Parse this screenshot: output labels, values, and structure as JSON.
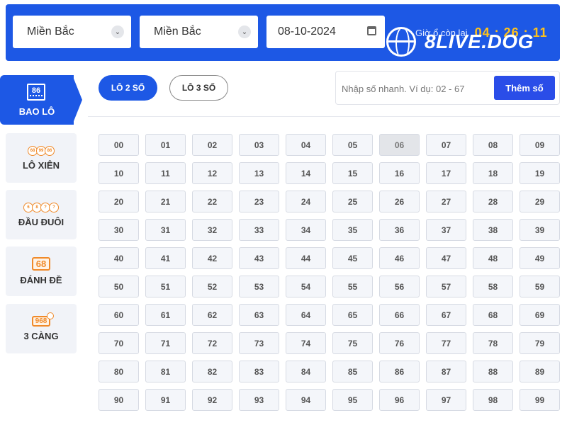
{
  "header": {
    "region1": "Miền Bắc",
    "region2": "Miền Bắc",
    "date": "08-10-2024",
    "timer_label": "Giờ ổ còn lại",
    "timer_value": "04 : 26 : 11",
    "watermark": "8LIVE.DOG"
  },
  "sidebar": {
    "items": [
      {
        "label": "BAO LÔ",
        "icon": "86-ticket-icon",
        "icon_text": "86"
      },
      {
        "label": "LÔ XIÊN",
        "icon": "balls-icon",
        "balls": [
          "68",
          "99",
          "86"
        ]
      },
      {
        "label": "ĐẦU ĐUÔI",
        "icon": "balls-question-icon",
        "balls": [
          "6",
          "8",
          "?",
          "?"
        ]
      },
      {
        "label": "ĐÁNH ĐỀ",
        "icon": "68-badge-icon",
        "icon_text": "68"
      },
      {
        "label": "3 CÀNG",
        "icon": "968-badge-icon",
        "icon_text": "968"
      }
    ]
  },
  "tabs": [
    {
      "label": "LÔ 2 SỐ",
      "active": true
    },
    {
      "label": "LÔ 3 SỐ",
      "active": false
    }
  ],
  "quick_input": {
    "placeholder": "Nhập số nhanh. Ví dụ: 02 - 67",
    "button_label": "Thêm số"
  },
  "grid": {
    "disabled": [
      "06"
    ]
  },
  "colors": {
    "primary": "#1d58e5",
    "timer": "#ffc21a",
    "icon_accent": "#f08a2a"
  }
}
